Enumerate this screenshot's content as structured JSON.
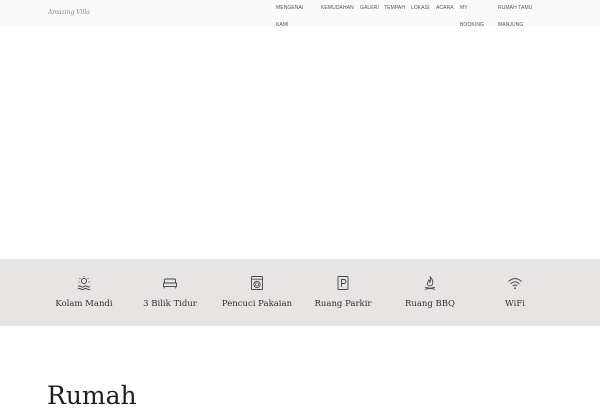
{
  "header": {
    "logo_text": "Amazing Villa",
    "nav": [
      {
        "label": "MENGENAI"
      },
      {
        "label": "KAMI"
      },
      {
        "label": "KEMUDAHAN"
      },
      {
        "label": "GALERI"
      },
      {
        "label": "TEMPAH"
      },
      {
        "label": "LOKASI"
      },
      {
        "label": "ACARA"
      },
      {
        "label": "MY"
      },
      {
        "label": "BOOKING"
      },
      {
        "label": "RUMAH TAMU"
      },
      {
        "label": "MANJUNG"
      }
    ]
  },
  "amenities": [
    {
      "label": "Kolam Mandi",
      "icon": "pool-icon"
    },
    {
      "label": "3 Bilik Tidur",
      "icon": "bed-icon"
    },
    {
      "label": "Pencuci Pakaian",
      "icon": "washing-machine-icon"
    },
    {
      "label": "Ruang Parkir",
      "icon": "parking-icon"
    },
    {
      "label": "Ruang BBQ",
      "icon": "bbq-fire-icon"
    },
    {
      "label": "WiFi",
      "icon": "wifi-icon"
    }
  ],
  "main": {
    "section_title": "Rumah"
  },
  "colors": {
    "amenity_band": "#e7e4e4",
    "header_bg": "#fafafa"
  }
}
